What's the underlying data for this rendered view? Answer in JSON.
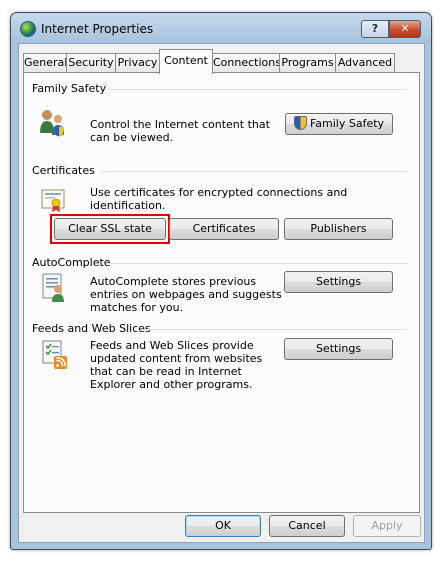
{
  "window": {
    "title": "Internet Properties",
    "help_label": "?",
    "close_label": "✕"
  },
  "tabs": [
    {
      "label": "General"
    },
    {
      "label": "Security"
    },
    {
      "label": "Privacy"
    },
    {
      "label": "Content"
    },
    {
      "label": "Connections"
    },
    {
      "label": "Programs"
    },
    {
      "label": "Advanced"
    }
  ],
  "family_safety": {
    "heading": "Family Safety",
    "description": "Control the Internet content that can be viewed.",
    "button": "Family Safety"
  },
  "certificates": {
    "heading": "Certificates",
    "description": "Use certificates for encrypted connections and identification.",
    "clear_ssl": "Clear SSL state",
    "certificates_button": "Certificates",
    "publishers_button": "Publishers"
  },
  "autocomplete": {
    "heading": "AutoComplete",
    "description": "AutoComplete stores previous entries on webpages and suggests matches for you.",
    "settings": "Settings"
  },
  "feeds": {
    "heading": "Feeds and Web Slices",
    "description": "Feeds and Web Slices provide updated content from websites that can be read in Internet Explorer and other programs.",
    "settings": "Settings"
  },
  "footer": {
    "ok": "OK",
    "cancel": "Cancel",
    "apply": "Apply"
  },
  "colors": {
    "highlight": "#e00000",
    "title_bar": "#a9c3dd"
  },
  "icons": [
    "ie-globe-icon",
    "family-safety-icon",
    "shield-icon",
    "certificate-icon",
    "autocomplete-icon",
    "feeds-icon"
  ]
}
